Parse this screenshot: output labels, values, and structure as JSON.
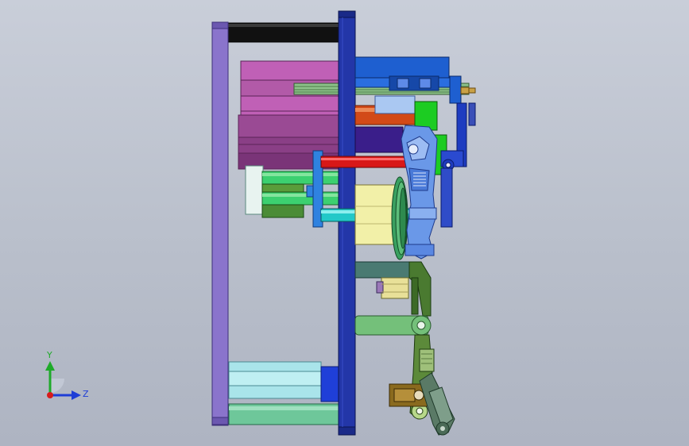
{
  "viewport": {
    "background_top": "#c9ced9",
    "background_bottom": "#aeb4c2"
  },
  "model": {
    "view": "side",
    "colors": {
      "outer_plate": "#8a74cc",
      "main_plate": "#2336a8",
      "top_rod": "#111111",
      "magenta_block": "#c060b6",
      "purple_block": "#9a4a94",
      "red_rod": "#d81818",
      "orange_rod": "#d24a18",
      "green_rod": "#3cd070",
      "cyan_rod": "#22c8c8",
      "yellow_block": "#f2f0a8",
      "blue_mechanism": "#1e5fd0",
      "light_blue_part": "#6a98e8",
      "green_part": "#1ccc22",
      "lever_green": "#74c07a",
      "dark_arm": "#4a7a30",
      "handle": "#5a7a66",
      "bottom_cylinder": "#a9e4ea",
      "bottom_rod": "#6ec79a",
      "bracket_brown": "#8a6a1e"
    }
  },
  "triad": {
    "y_label": "Y",
    "z_label": "Z",
    "y_color": "#1faa2a",
    "z_color": "#1e3dd6",
    "x_color": "#d81b1b"
  }
}
